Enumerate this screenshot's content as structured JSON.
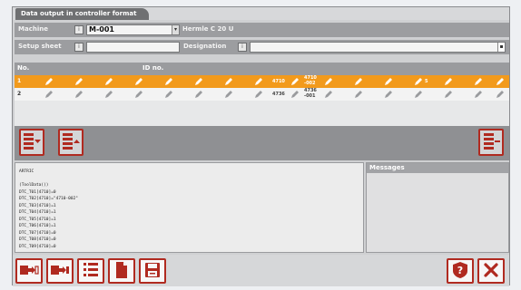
{
  "window": {
    "tab_title": "Data output in controller format"
  },
  "machine_row": {
    "machine_label": "Machine",
    "machine_value": "M-001",
    "machine_name": "Hermle C 20 U",
    "info_icon": "info-icon"
  },
  "setup_row": {
    "setup_label": "Setup sheet",
    "designation_label": "Designation",
    "setup_value": "",
    "designation_value": ""
  },
  "table": {
    "columns": [
      "No.",
      "ID no."
    ],
    "rows": [
      {
        "no": "1",
        "id_short": "4710",
        "id_long_1": "4710",
        "id_long_2": "-002",
        "tail": "5",
        "selected": true
      },
      {
        "no": "2",
        "id_short": "4736",
        "id_long_1": "4736",
        "id_long_2": "-001",
        "tail": "",
        "selected": false
      }
    ]
  },
  "code_lines": [
    "ARTRIC",
    "",
    "(ToolData())",
    "DTC_T01[4710]=0",
    "DTC_T02[4710]=\"4710-002\"",
    "DTC_T03[4710]=1",
    "DTC_T04[4710]=1",
    "DTC_T05[4710]=1",
    "DTC_T06[4710]=1",
    "DTC_T07[4710]=0",
    "DTC_T08[4710]=0",
    "DTC_T09[4710]=0"
  ],
  "messages": {
    "title": "Messages"
  },
  "colors": {
    "accent": "#f29a1c",
    "button_border": "#b02a20",
    "header": "#9a9b9e"
  }
}
